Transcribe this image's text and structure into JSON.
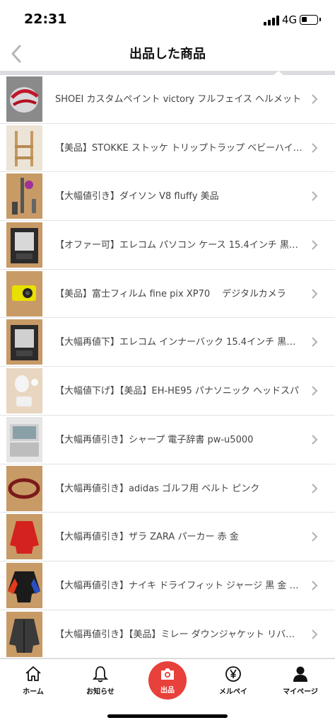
{
  "status": {
    "time": "22:31",
    "network": "4G"
  },
  "header": {
    "title": "出品した商品"
  },
  "items": [
    {
      "title": "SHOEI カスタムペイント victory フルフェイス ヘルメット"
    },
    {
      "title": "【美品】STOKKE ストッケ トリップトラップ ベビーハイ…"
    },
    {
      "title": "【大幅値引き】ダイソン V8 fluffy 美品"
    },
    {
      "title": "【オファー可】エレコム パソコン ケース 15.4インチ 黒…"
    },
    {
      "title": "【美品】富士フィルム fine pix XP70　 デジタルカメラ"
    },
    {
      "title": "【大幅再値下】エレコム インナーバック 15.4インチ 黒…"
    },
    {
      "title": "【大幅値下げ】【美品】EH-HE95 パナソニック ヘッドスパ"
    },
    {
      "title": "【大幅再値引き】シャープ 電子辞書 pw-u5000"
    },
    {
      "title": "【大幅再値引き】adidas ゴルフ用 ベルト ピンク"
    },
    {
      "title": "【大幅再値引き】ザラ ZARA パーカー 赤 金"
    },
    {
      "title": "【大幅再値引き】ナイキ ドライフィット ジャージ 黒 金 青…"
    },
    {
      "title": "【大幅再値引き】【美品】ミレー ダウンジャケット リバ…"
    }
  ],
  "tabs": {
    "home": "ホーム",
    "notifications": "お知らせ",
    "sell": "出品",
    "pay": "メルペイ",
    "mypage": "マイページ"
  },
  "colors": {
    "accent": "#e8403a",
    "divider": "#dcdce0"
  }
}
